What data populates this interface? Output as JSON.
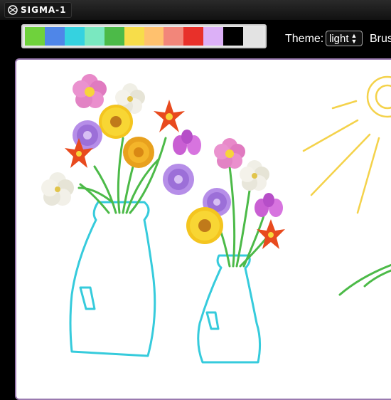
{
  "app": {
    "title": "SIGMA-1"
  },
  "toolbar": {
    "palette": [
      {
        "name": "lime",
        "color": "#6fd23c"
      },
      {
        "name": "blue",
        "color": "#4f86e8"
      },
      {
        "name": "cyan",
        "color": "#35d2e0"
      },
      {
        "name": "mint",
        "color": "#7ae8c0"
      },
      {
        "name": "green",
        "color": "#4cba48"
      },
      {
        "name": "yellow",
        "color": "#f7dd4a"
      },
      {
        "name": "orange",
        "color": "#ffc16e"
      },
      {
        "name": "salmon",
        "color": "#f2867a"
      },
      {
        "name": "red",
        "color": "#e8302a"
      },
      {
        "name": "lavender",
        "color": "#dcb0f7"
      },
      {
        "name": "black",
        "color": "#000000"
      },
      {
        "name": "light-gray",
        "color": "#e3e3e3"
      }
    ],
    "theme_label": "Theme:",
    "theme_value": "light",
    "brush_label": "Brush"
  },
  "canvas": {
    "strokes": {
      "vase_color": "#36cbdc",
      "stem_color": "#4cba48",
      "sun_color": "#f4d24a"
    }
  }
}
